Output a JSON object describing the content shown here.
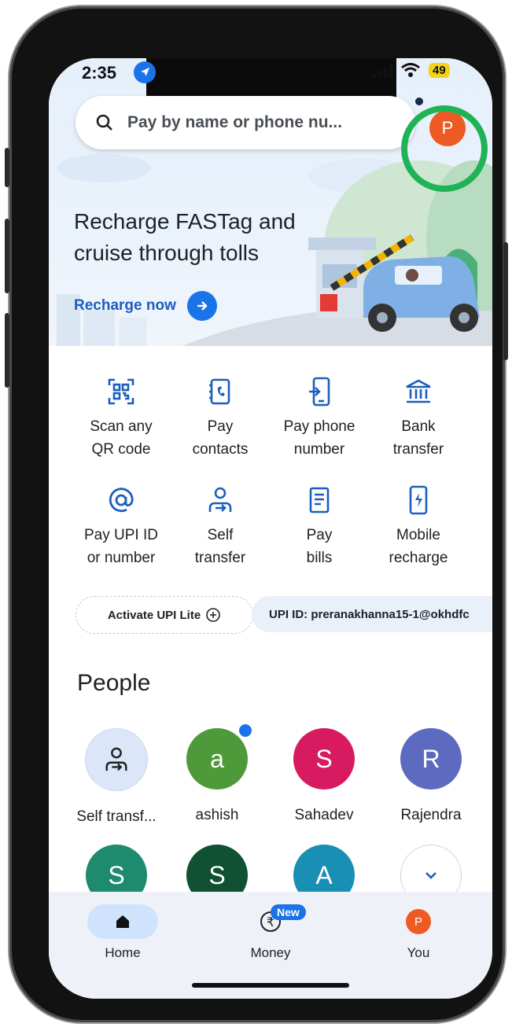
{
  "status_bar": {
    "time": "2:35",
    "battery": "49"
  },
  "search": {
    "placeholder": "Pay by name or phone nu..."
  },
  "profile": {
    "initial": "P"
  },
  "promo": {
    "title": "Recharge FASTag and cruise through tolls",
    "link": "Recharge now"
  },
  "actions": [
    {
      "label": "Scan any QR code",
      "icon": "qr-scan-icon"
    },
    {
      "label": "Pay contacts",
      "icon": "contacts-icon"
    },
    {
      "label": "Pay phone number",
      "icon": "phone-pay-icon"
    },
    {
      "label": "Bank transfer",
      "icon": "bank-icon"
    },
    {
      "label": "Pay UPI ID or number",
      "icon": "at-sign-icon"
    },
    {
      "label": "Self transfer",
      "icon": "self-transfer-icon"
    },
    {
      "label": "Pay bills",
      "icon": "bill-icon"
    },
    {
      "label": "Mobile recharge",
      "icon": "mobile-recharge-icon"
    }
  ],
  "chips": {
    "upi_lite": "Activate UPI Lite",
    "upi_id": "UPI ID: preranakhanna15-1@okhdfc"
  },
  "people": {
    "title": "People",
    "items": [
      {
        "name": "Self transf...",
        "initial": "",
        "color": "#dbe7f8"
      },
      {
        "name": "ashish",
        "initial": "a",
        "color": "#4e9a3a"
      },
      {
        "name": "Sahadev",
        "initial": "S",
        "color": "#d81b60"
      },
      {
        "name": "Rajendra",
        "initial": "R",
        "color": "#5c6bc0"
      }
    ],
    "row2": [
      {
        "initial": "S",
        "color": "#1e8a6e"
      },
      {
        "initial": "S",
        "color": "#0f5132"
      },
      {
        "initial": "A",
        "color": "#1a8fb5"
      }
    ]
  },
  "nav": {
    "home": "Home",
    "money": "Money",
    "money_badge": "New",
    "you": "You",
    "you_initial": "P"
  },
  "colors": {
    "accent": "#1a73e8",
    "highlight_ring": "#1fb356",
    "avatar": "#ee5a24"
  }
}
